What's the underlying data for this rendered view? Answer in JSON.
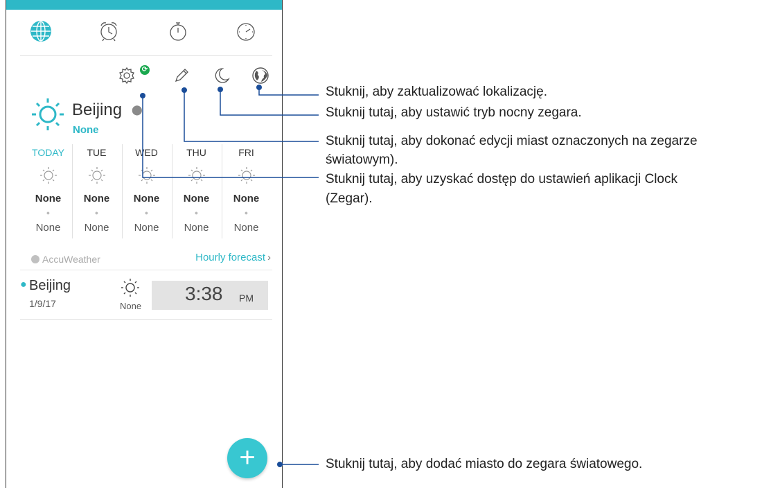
{
  "tabs": [
    {
      "name": "world-clock",
      "icon": "globe-icon",
      "active": true
    },
    {
      "name": "alarm",
      "icon": "alarm-clock-icon"
    },
    {
      "name": "stopwatch",
      "icon": "stopwatch-icon"
    },
    {
      "name": "timer",
      "icon": "timer-icon"
    }
  ],
  "toolbar": {
    "settings_icon": "gear-icon",
    "edit_icon": "pencil-icon",
    "night_icon": "moon-icon",
    "location_icon": "globe-location-icon"
  },
  "city": {
    "name": "Beijing",
    "condition": "None"
  },
  "forecast": [
    {
      "day": "TODAY",
      "high": "None",
      "low": "None"
    },
    {
      "day": "TUE",
      "high": "None",
      "low": "None"
    },
    {
      "day": "WED",
      "high": "None",
      "low": "None"
    },
    {
      "day": "THU",
      "high": "None",
      "low": "None"
    },
    {
      "day": "FRI",
      "high": "None",
      "low": "None"
    }
  ],
  "accuweather": {
    "brand": "AccuWeather",
    "hourly": "Hourly forecast"
  },
  "world_clock": {
    "city": "Beijing",
    "date": "1/9/17",
    "condition": "None",
    "time": "3:38",
    "ampm": "PM"
  },
  "fab": {
    "label": "+"
  },
  "callouts": {
    "location": "Stuknij, aby zaktualizować lokalizację.",
    "night": "Stuknij tutaj, aby ustawić tryb nocny zegara.",
    "edit_line1": "Stuknij tutaj, aby dokonać edycji miast oznaczonych na zegarze",
    "edit_line2": "światowym).",
    "settings_line1": "Stuknij tutaj, aby uzyskać dostęp do ustawień aplikacji Clock",
    "settings_line2": "(Zegar).",
    "add": "Stuknij tutaj, aby dodać miasto do zegara światowego."
  },
  "colors": {
    "accent": "#2eb8c7",
    "fab": "#38c7d1",
    "callout_line": "#1a4d99",
    "sync_badge": "#1aa84f"
  }
}
